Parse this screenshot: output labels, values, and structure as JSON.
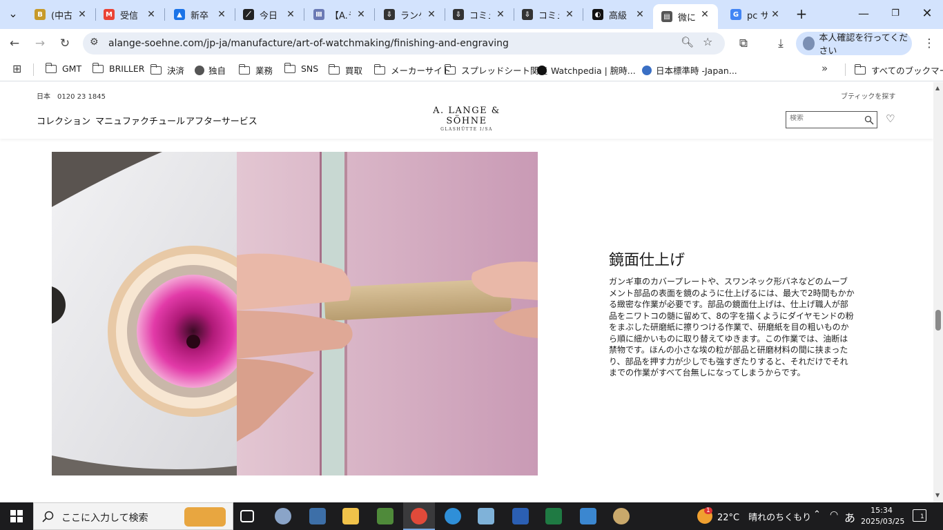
{
  "browser": {
    "tabs": [
      {
        "title": "(中古",
        "favicon": "B",
        "color": "#c79a2a"
      },
      {
        "title": "受信",
        "favicon": "M",
        "color": "#ea4335"
      },
      {
        "title": "新卒",
        "favicon": "▲",
        "color": "#1a73e8"
      },
      {
        "title": "今日",
        "favicon": "⟋",
        "color": "#222222"
      },
      {
        "title": "【A.ラ",
        "favicon": "Ⅲ",
        "color": "#6b7ab5"
      },
      {
        "title": "ランゲ",
        "favicon": "⇩",
        "color": "#333333"
      },
      {
        "title": "コミュ",
        "favicon": "⇩",
        "color": "#333333"
      },
      {
        "title": "コミュ",
        "favicon": "⇩",
        "color": "#333333"
      },
      {
        "title": "高級",
        "favicon": "◐",
        "color": "#111111"
      },
      {
        "title": "微に",
        "favicon": "▤",
        "color": "#555555",
        "active": true
      },
      {
        "title": "pc サ",
        "favicon": "G",
        "color": "#4285f4"
      }
    ],
    "new_tab_label": "+",
    "url": "alange-soehne.com/jp-ja/manufacture/art-of-watchmaking/finishing-and-engraving",
    "profile_label": "本人確認を行ってください",
    "bookmarks": [
      {
        "label": "GMT",
        "icon": "folder-icon"
      },
      {
        "label": "BRILLER",
        "icon": "folder-icon"
      },
      {
        "label": "決済",
        "icon": "folder-icon"
      },
      {
        "label": "独自",
        "icon": "globe-icon"
      },
      {
        "label": "業務",
        "icon": "folder-icon"
      },
      {
        "label": "SNS",
        "icon": "folder-icon"
      },
      {
        "label": "買取",
        "icon": "folder-icon"
      },
      {
        "label": "メーカーサイト",
        "icon": "folder-icon"
      },
      {
        "label": "スプレッドシート関連",
        "icon": "folder-icon"
      },
      {
        "label": "Watchpedia | 腕時...",
        "icon": "watchpedia-icon"
      },
      {
        "label": "日本標準時 -Japan...",
        "icon": "nict-icon"
      }
    ],
    "bookmarks_more": "»",
    "all_bookmarks_label": "すべてのブックマーク"
  },
  "site": {
    "phone": "日本　0120 23 1845",
    "boutique_link": "ブティックを探す",
    "nav": [
      "コレクション",
      "マニュファクチュール",
      "アフターサービス"
    ],
    "logo_line1": "A. LANGE & SÖHNE",
    "logo_line2": "GLASHÜTTE I/SA",
    "search_placeholder": "検索"
  },
  "content": {
    "title": "鏡面仕上げ",
    "body": "ガンギ車のカバープレートや、スワンネック形バネなどのムーブメント部品の表面を鏡のように仕上げるには、最大で2時間もかかる緻密な作業が必要です。部品の鏡面仕上げは、仕上げ職人が部品をニワトコの髄に留めて、8の字を描くようにダイヤモンドの粉をまぶした研磨紙に擦りつける作業で、研磨紙を目の粗いものから順に細かいものに取り替えてゆきます。この作業では、油断は禁物です。ほんの小さな埃の粒が部品と研磨材料の間に挟まったり、部品を押す力が少しでも強すぎたりすると、それだけでそれまでの作業がすべて台無しになってしまうからです。"
  },
  "taskbar": {
    "search_placeholder": "ここに入力して検索",
    "weather": "22°C　晴れのちくもり",
    "time": "15:34",
    "date": "2025/03/25",
    "ime": "あ",
    "notification_count": "1",
    "weather_badge": "1"
  }
}
